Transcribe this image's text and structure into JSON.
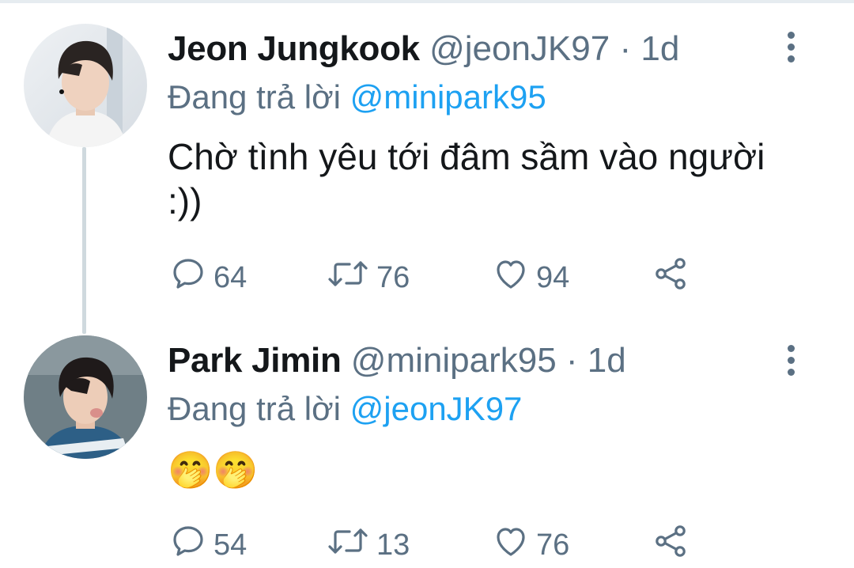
{
  "tweets": [
    {
      "name": "Jeon Jungkook",
      "handle": "@jeonJK97",
      "separator": "·",
      "time": "1d",
      "replying_prefix": "Đang trả lời",
      "replying_to": "@minipark95",
      "text": "Chờ tình yêu tới đâm sầm vào người :))",
      "reply_count": "64",
      "retweet_count": "76",
      "like_count": "94"
    },
    {
      "name": "Park Jimin",
      "handle": "@minipark95",
      "separator": "·",
      "time": "1d",
      "replying_prefix": "Đang trả lời",
      "replying_to": "@jeonJK97",
      "text": "🤭🤭",
      "reply_count": "54",
      "retweet_count": "13",
      "like_count": "76"
    }
  ],
  "colors": {
    "accent": "#1da1f2",
    "secondary_text": "#5b7083",
    "thread_line": "#cfd9de"
  },
  "icons": [
    "reply-icon",
    "retweet-icon",
    "like-icon",
    "share-icon",
    "more-options-icon"
  ]
}
